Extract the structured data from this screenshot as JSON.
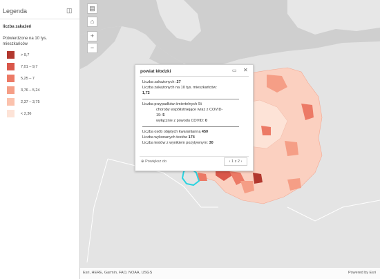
{
  "legend": {
    "title": "Legenda",
    "layer_title": "liczba zakażeń",
    "field_label": "Potwierdzone na 10 tys. mieszkańców",
    "classes": [
      {
        "label": "> 9,7",
        "color": "#b2382f"
      },
      {
        "label": "7,01 – 9,7",
        "color": "#d9574a"
      },
      {
        "label": "5,25 – 7",
        "color": "#ec7a66"
      },
      {
        "label": "3,76 – 5,24",
        "color": "#f59e86"
      },
      {
        "label": "2,37 – 3,75",
        "color": "#fbc2ad"
      },
      {
        "label": "< 2,36",
        "color": "#fde3d7"
      }
    ]
  },
  "map_controls": {
    "basemap_icon": "basemap-gallery-icon",
    "home_icon": "home-icon",
    "zoom_in": "+",
    "zoom_out": "−"
  },
  "popup": {
    "title": "powiat kłodzki",
    "line1_label": "Liczba zakażonych:",
    "line1_value": "27",
    "line2_label": "Liczba zakażonych na 10 tys. mieszkańców:",
    "line2_value": "1,72",
    "line3": "Liczba przypadków śmiertelnych St",
    "line4": "choroby współistniejące wraz z COVID-",
    "line5_label": "19:",
    "line5_value": "5",
    "line6_label": "wyłącznie z powodu COVID:",
    "line6_value": "0",
    "line7_label": "Liczba osób objętych kwarantanną",
    "line7_value": "450",
    "line8_label": "Liczba wykonanych testów",
    "line8_value": "174",
    "line9_label": "Liczba testów z wynikiem pozytywnym:",
    "line9_value": "30",
    "zoom_to": "Powiększ do",
    "pager": "1 z 2"
  },
  "attribution": {
    "left": "Esri, HERE, Garmin, FAO, NOAA, USGS",
    "right": "Powered by Esri"
  }
}
